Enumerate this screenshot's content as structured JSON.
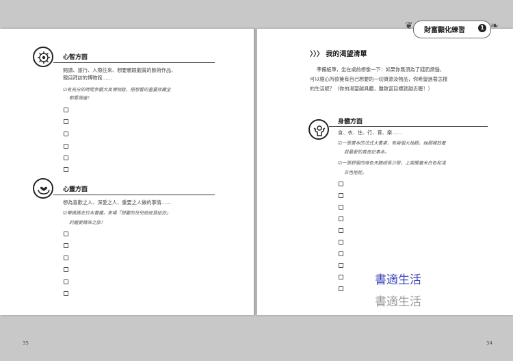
{
  "header": {
    "badge_title": "財富顯化練習",
    "badge_number": "1"
  },
  "left_page": {
    "page_number": "35",
    "sections": [
      {
        "title": "心智方面",
        "icon": "brain-gear-icon",
        "lines": [
          "閱讀、旅行、人際往來、想要親眼觀賞的藝術作品、",
          "親自拜訪的博物館……"
        ],
        "handwritten": [
          "☑有充分的時間參觀大英博物館，把想看的畫要收藏全",
          "都看個遍！"
        ]
      },
      {
        "title": "心靈方面",
        "icon": "hands-heart-icon",
        "lines": [
          "想為喜歡之人、深愛之人、重要之人做的事情……"
        ],
        "handwritten": [
          "☑帶媽媽去日本書櫃，來場「想要的世兒統統買給你」",
          "的寵愛媽咪之旅！"
        ]
      }
    ]
  },
  "right_page": {
    "page_number": "34",
    "list_title": "〉〉〉 我的渴望清單",
    "intro": [
      "準備紙筆，坐在桌前想像一下：如果你無須為了錢而煩惱，",
      "可以隨心所欲擁有自己想要的一切資源及物品，你希望過著怎樣",
      "的生活呢？（你的渴望越具體，離致富目標就越近喔！）"
    ],
    "section": {
      "title": "身體方面",
      "icon": "strong-person-icon",
      "lines": [
        "食、衣、住、行、育、樂……"
      ],
      "handwritten": [
        "☑一張書本的法式大書桌，有兩個大抽屜，抽屜裡放著",
        "我最愛的真皮記事本。",
        "☑一張舒服的綠色天鵝絨長沙發，上面擺著米白色和淺",
        "灰色抱枕。"
      ]
    },
    "watermark": "書適生活"
  }
}
